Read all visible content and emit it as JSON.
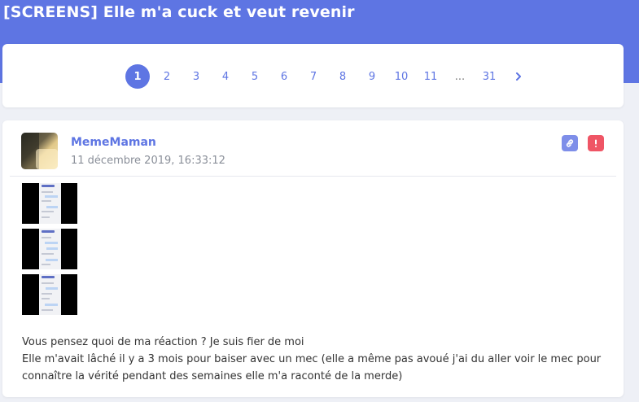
{
  "topic": {
    "title": "[SCREENS] Elle m'a cuck et veut revenir"
  },
  "pagination": {
    "pages": [
      "1",
      "2",
      "3",
      "4",
      "5",
      "6",
      "7",
      "8",
      "9",
      "10",
      "11"
    ],
    "ellipsis": "...",
    "last": "31",
    "current": "1"
  },
  "post": {
    "author": "MemeMaman",
    "date": "11 décembre 2019, 16:33:12",
    "text_lines": [
      "Vous pensez quoi de ma réaction ? Je suis fier de moi",
      "Elle m'avait lâché il y a 3 mois pour baiser avec un mec (elle a même pas avoué j'ai du aller voir le mec pour",
      "connaître la vérité pendant des semaines elle m'a raconté de la merde)"
    ],
    "images": [
      "screenshot-1",
      "screenshot-2",
      "screenshot-3"
    ]
  },
  "colors": {
    "accent": "#5e75e3",
    "report": "#ef5565",
    "link": "#7e8ee9"
  },
  "icons": {
    "link": "link-icon",
    "report": "exclamation-icon",
    "next": "chevron-right-icon"
  }
}
